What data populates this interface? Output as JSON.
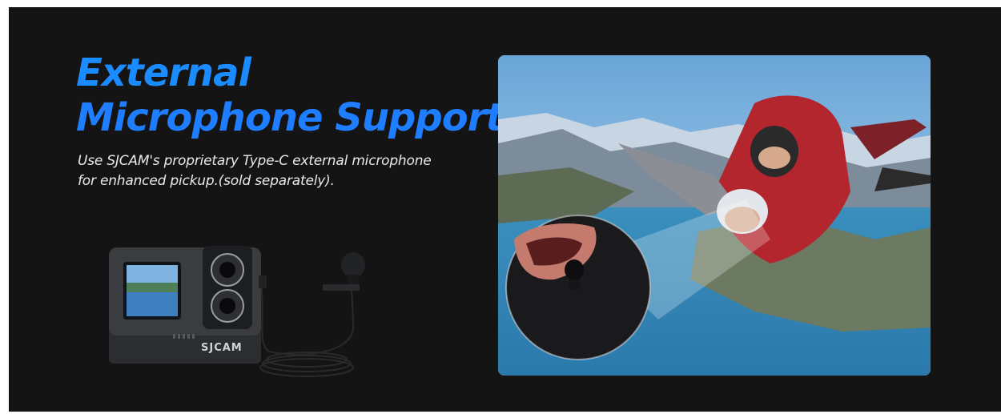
{
  "headline": {
    "line1": "External",
    "line2": "Microphone Support"
  },
  "description": {
    "line1": "Use SJCAM's proprietary Type-C external microphone",
    "line2": "for enhanced pickup.(sold separately)."
  },
  "product": {
    "brand_logo": "SJCAM",
    "camera_icon": "action-camera-icon",
    "microphone_icon": "lavalier-microphone-icon"
  },
  "photo": {
    "scene": "skydiving-tandem-photo",
    "inset": "microphone-closeup-inset"
  },
  "colors": {
    "background": "#141414",
    "headline_blue": "#1a8cff",
    "text": "#e9e9e9"
  }
}
